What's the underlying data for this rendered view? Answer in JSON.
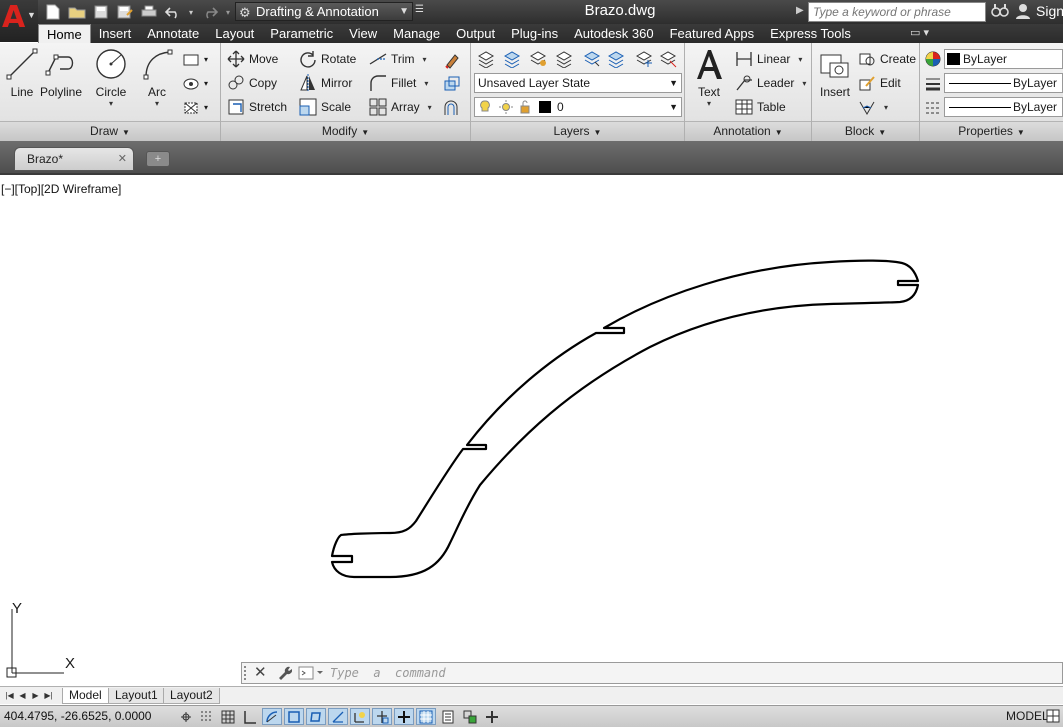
{
  "app": {
    "document_title": "Brazo.dwg",
    "workspace": "Drafting & Annotation",
    "search_placeholder": "Type a keyword or phrase",
    "sign_in": "Sign",
    "accent_color": "#d9231d"
  },
  "ribbon_tabs": [
    "Home",
    "Insert",
    "Annotate",
    "Layout",
    "Parametric",
    "View",
    "Manage",
    "Output",
    "Plug-ins",
    "Autodesk 360",
    "Featured Apps",
    "Express Tools"
  ],
  "panels": {
    "draw": {
      "title": "Draw",
      "line": "Line",
      "polyline": "Polyline",
      "circle": "Circle",
      "arc": "Arc"
    },
    "modify": {
      "title": "Modify",
      "move": "Move",
      "rotate": "Rotate",
      "trim": "Trim",
      "copy": "Copy",
      "mirror": "Mirror",
      "fillet": "Fillet",
      "stretch": "Stretch",
      "scale": "Scale",
      "array": "Array"
    },
    "layers": {
      "title": "Layers",
      "layer_state": "Unsaved Layer State",
      "current_layer": "0"
    },
    "annotation": {
      "title": "Annotation",
      "text": "Text",
      "linear": "Linear",
      "leader": "Leader",
      "table": "Table"
    },
    "block": {
      "title": "Block",
      "insert": "Insert",
      "create": "Create",
      "edit": "Edit"
    },
    "properties": {
      "title": "Properties",
      "color": "ByLayer",
      "lineweight": "ByLayer",
      "linetype": "ByLayer"
    }
  },
  "file_tab": {
    "name": "Brazo*"
  },
  "viewport": {
    "label": "[−][Top][2D Wireframe]",
    "ucs_x": "X",
    "ucs_y": "Y"
  },
  "command": {
    "placeholder": "Type  a  command"
  },
  "layout_tabs": [
    "Model",
    "Layout1",
    "Layout2"
  ],
  "status": {
    "coordinates": "404.4795, -26.6525, 0.0000",
    "space": "MODEL"
  }
}
